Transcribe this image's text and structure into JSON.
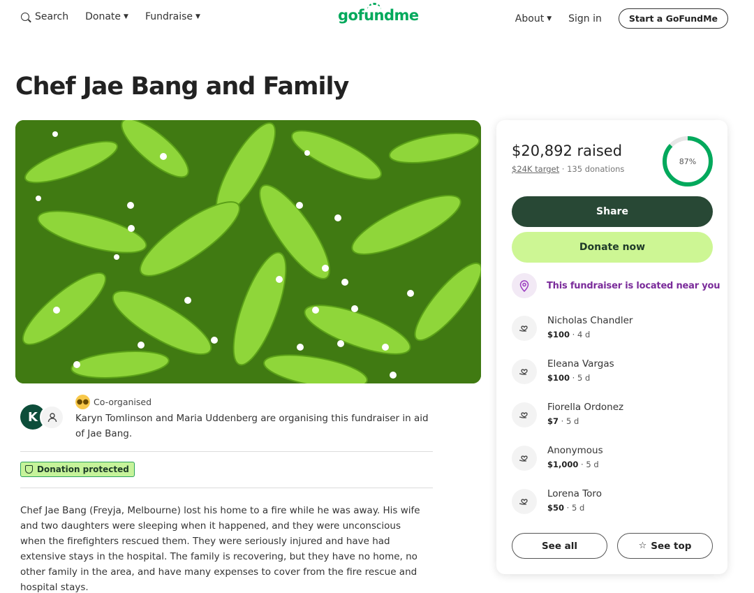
{
  "nav": {
    "search_label": "Search",
    "donate_label": "Donate",
    "fundraise_label": "Fundraise",
    "logo_text": "gofundme",
    "about_label": "About",
    "signin_label": "Sign in",
    "start_label": "Start a GoFundMe"
  },
  "page": {
    "title": "Chef Jae Bang and Family"
  },
  "organizers": {
    "avatar_initial": "K",
    "badge_label": "Co-organised",
    "text": "Karyn Tomlinson and Maria Uddenberg are organising this fundraiser in aid of Jae Bang.",
    "protected_label": "Donation protected"
  },
  "story": {
    "text": "Chef Jae Bang (Freyja, Melbourne) lost his home to a fire while he was away. His wife and two daughters were sleeping when it happened, and they were unconscious when the firefighters rescued them. They were seriously injured and have had extensive stays in the hospital. The family is recovering, but they have no home, no other family in the area, and have many expenses to cover from the fire rescue and hospital stays."
  },
  "sidebar": {
    "raised": "$20,892 raised",
    "target": "$24K target",
    "separator": "·",
    "donations": "135 donations",
    "progress_label": "87%",
    "progress_fraction": 0.87,
    "share_label": "Share",
    "donate_label": "Donate now",
    "near_label": "This fundraiser is located near you",
    "donors": [
      {
        "name": "Nicholas Chandler",
        "amount": "$100",
        "time": " · 4 d"
      },
      {
        "name": "Eleana Vargas",
        "amount": "$100",
        "time": " · 5 d"
      },
      {
        "name": "Fiorella Ordonez",
        "amount": "$7",
        "time": " · 5 d"
      },
      {
        "name": "Anonymous",
        "amount": "$1,000",
        "time": " · 5 d"
      },
      {
        "name": "Lorena Toro",
        "amount": "$50",
        "time": " · 5 d"
      }
    ],
    "see_all_label": "See all",
    "see_top_label": "See top"
  },
  "colors": {
    "brand_green": "#02a95c",
    "share_button": "#284835",
    "donate_button": "#cdf694",
    "near_purple": "#7a2b9a"
  },
  "icons": [
    "search-icon",
    "chevron-down-icon",
    "person-icon",
    "group-icon",
    "shield-icon",
    "location-pin-icon",
    "heart-hand-icon",
    "star-icon"
  ]
}
